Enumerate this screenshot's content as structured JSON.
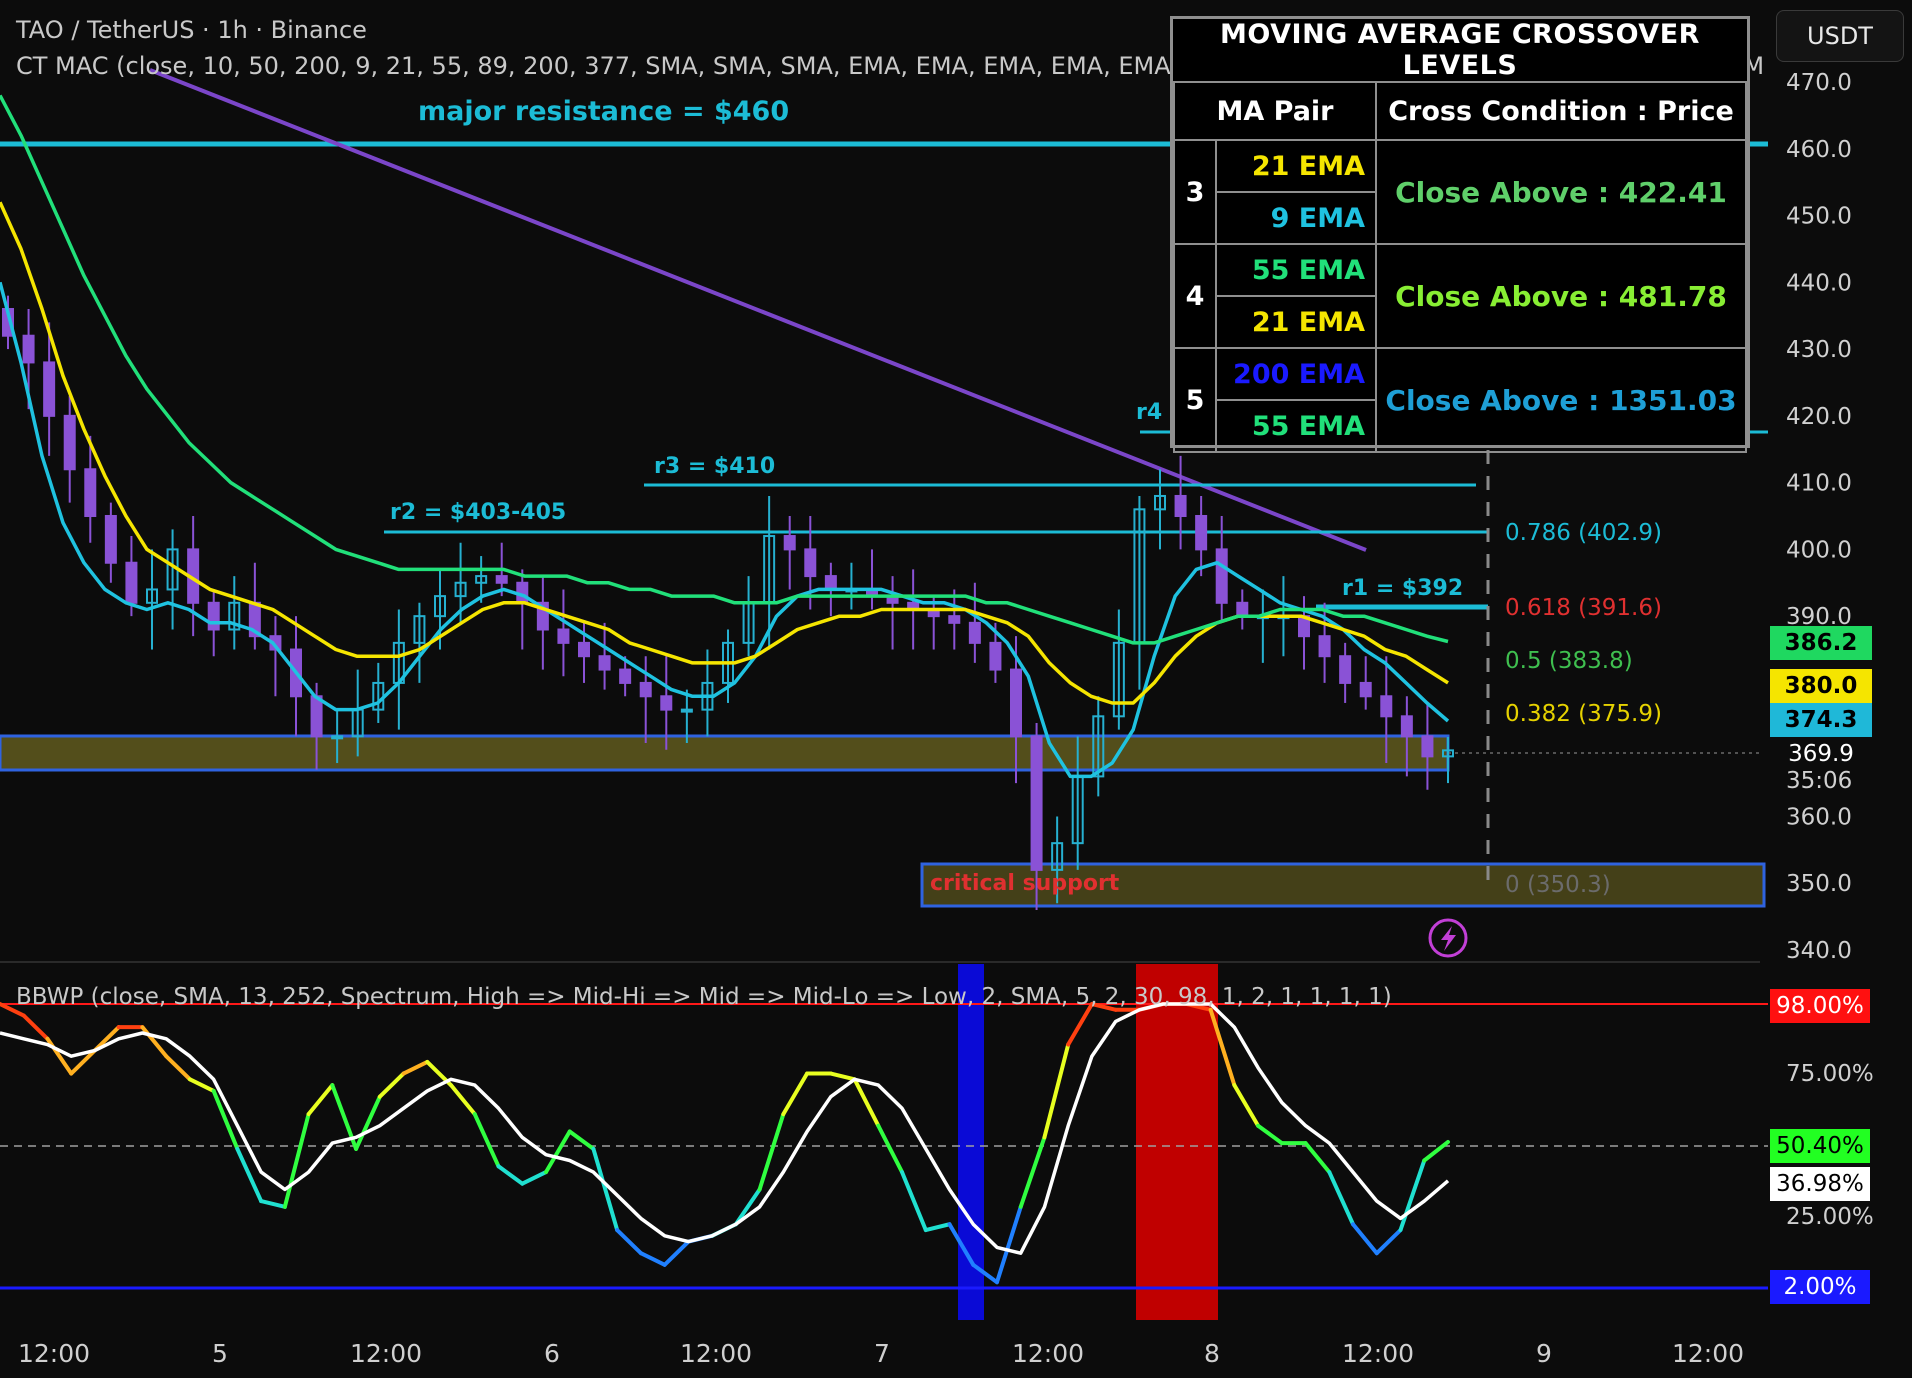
{
  "header": {
    "symbol_line": "TAO / TetherUS · 1h · Binance",
    "indicator_line": "CT MAC (close, 10, 50, 200, 9, 21, 55, 89, 200, 377, SMA, SMA, SMA, EMA, EMA, EMA, EMA, EMA, 2, MA 1, MA 2, MA 2, MA 3, MA 4, MA 5, MA 5, M",
    "currency_button": "USDT"
  },
  "ma_table": {
    "title": "MOVING AVERAGE CROSSOVER LEVELS",
    "col_pair": "MA Pair",
    "col_cond": "Cross Condition : Price",
    "rows": [
      {
        "idx": "3",
        "ma_a": "21 EMA",
        "ma_a_color": "#f5e500",
        "ma_b": "9 EMA",
        "ma_b_color": "#1fc2e0",
        "cond": "Close Above : 422.41",
        "cond_color": "#5fcf6a"
      },
      {
        "idx": "4",
        "ma_a": "55 EMA",
        "ma_a_color": "#21e07a",
        "ma_b": "21 EMA",
        "ma_b_color": "#f5e500",
        "cond": "Close Above : 481.78",
        "cond_color": "#88ee33"
      },
      {
        "idx": "5",
        "ma_a": "200 EMA",
        "ma_a_color": "#1a1aff",
        "ma_b": "55 EMA",
        "ma_b_color": "#21e07a",
        "cond": "Close Above : 1351.03",
        "cond_color": "#1e9fd6"
      }
    ]
  },
  "annotations": {
    "major_resistance": "major resistance = $460",
    "r1": "r1 = $392",
    "r2": "r2 = $403-405",
    "r3": "r3 = $410",
    "r4": "r4 =",
    "critical_support": "critical support",
    "fib_0786": "0.786 (402.9)",
    "fib_0618": "0.618 (391.6)",
    "fib_05": "0.5 (383.8)",
    "fib_0382": "0.382 (375.9)",
    "fib_0": "0 (350.3)",
    "countdown": "35:06"
  },
  "price_tags": [
    {
      "text": "386.2",
      "bg": "#1fd860",
      "fg": "#000000"
    },
    {
      "text": "380.0",
      "bg": "#f5e500",
      "fg": "#000000"
    },
    {
      "text": "374.3",
      "bg": "#1fb8d8",
      "fg": "#000000"
    },
    {
      "text": "369.9",
      "bg": "#0c0c0c",
      "fg": "#ffffff"
    }
  ],
  "bbwp": {
    "label": "BBWP (close, SMA, 13, 252, Spectrum, High => Mid-Hi => Mid => Mid-Lo => Low, 2, SMA, 5, 2, 30, 98, 1, 2, 1, 1, 1, 1)",
    "y_ticks": [
      "75.00%",
      "25.00%"
    ],
    "tags": [
      {
        "text": "98.00%",
        "bg": "#ff1010",
        "fg": "#ffffff"
      },
      {
        "text": "50.40%",
        "bg": "#22ff22",
        "fg": "#000000"
      },
      {
        "text": "36.98%",
        "bg": "#ffffff",
        "fg": "#000000"
      },
      {
        "text": "2.00%",
        "bg": "#1a1aff",
        "fg": "#ffffff"
      }
    ]
  },
  "chart_data": {
    "type": "candlestick",
    "title": "TAO / TetherUS · 1h · Binance",
    "y_axis_ticks": [
      470.0,
      460.0,
      450.0,
      440.0,
      430.0,
      420.0,
      410.0,
      400.0,
      390.0,
      380.0,
      370.0,
      360.0,
      350.0,
      340.0
    ],
    "ylim": [
      338,
      474
    ],
    "x_axis_ticks": [
      "12:00",
      "5",
      "12:00",
      "6",
      "12:00",
      "7",
      "12:00",
      "8",
      "12:00",
      "9",
      "12:00"
    ],
    "last_price": 369.9,
    "close_series_approx": [
      432,
      428,
      420,
      412,
      405,
      398,
      392,
      394,
      400,
      392,
      388,
      392,
      387,
      385,
      378,
      372,
      372,
      376,
      380,
      386,
      390,
      393,
      395,
      396,
      395,
      392,
      388,
      386,
      384,
      382,
      380,
      378,
      376,
      376,
      380,
      386,
      392,
      402,
      400,
      396,
      394,
      394,
      393,
      392,
      391,
      390,
      389,
      386,
      382,
      372,
      352,
      356,
      366,
      375,
      386,
      406,
      408,
      405,
      400,
      392,
      390,
      390,
      390,
      387,
      384,
      380,
      378,
      375,
      372,
      369,
      369.9
    ],
    "moving_averages": [
      {
        "name": "9 EMA",
        "color": "#1fc2e0",
        "values": [
          440,
          428,
          414,
          404,
          398,
          394,
          392,
          391,
          392,
          391,
          389,
          389,
          388,
          386,
          382,
          378,
          376,
          376,
          377,
          380,
          384,
          388,
          391,
          393,
          394,
          393,
          391,
          389,
          387,
          385,
          383,
          381,
          379,
          378,
          378,
          380,
          384,
          390,
          393,
          394,
          394,
          394,
          394,
          393,
          392,
          392,
          391,
          389,
          386,
          381,
          371,
          366,
          366,
          368,
          373,
          384,
          393,
          397,
          398,
          396,
          394,
          392,
          391,
          390,
          388,
          385,
          383,
          380,
          377,
          374.3
        ]
      },
      {
        "name": "21 EMA",
        "color": "#f5e500",
        "values": [
          452,
          445,
          436,
          426,
          418,
          411,
          405,
          400,
          398,
          396,
          394,
          393,
          392,
          391,
          389,
          387,
          385,
          384,
          384,
          384,
          385,
          387,
          389,
          391,
          392,
          392,
          391,
          390,
          389,
          388,
          386,
          385,
          384,
          383,
          383,
          383,
          384,
          386,
          388,
          389,
          390,
          390,
          391,
          391,
          391,
          391,
          391,
          390,
          389,
          387,
          383,
          380,
          378,
          377,
          377,
          380,
          384,
          387,
          389,
          390,
          390,
          390,
          390,
          389,
          388,
          387,
          385,
          384,
          382,
          380.0
        ]
      },
      {
        "name": "55 EMA",
        "color": "#21e07a",
        "values": [
          468,
          462,
          455,
          448,
          441,
          435,
          429,
          424,
          420,
          416,
          413,
          410,
          408,
          406,
          404,
          402,
          400,
          399,
          398,
          397,
          397,
          397,
          397,
          397,
          397,
          396,
          396,
          396,
          395,
          395,
          394,
          394,
          393,
          393,
          393,
          392,
          392,
          392,
          393,
          393,
          393,
          393,
          393,
          393,
          393,
          393,
          393,
          392,
          392,
          391,
          390,
          389,
          388,
          387,
          386,
          386,
          387,
          388,
          389,
          390,
          390,
          391,
          391,
          391,
          390,
          390,
          389,
          388,
          387,
          386.2
        ]
      }
    ],
    "bbwp_series": {
      "name": "BBWP",
      "ylim": [
        0,
        100
      ],
      "values": [
        98,
        94,
        86,
        74,
        82,
        90,
        90,
        80,
        72,
        68,
        48,
        30,
        28,
        60,
        70,
        48,
        66,
        74,
        78,
        70,
        60,
        42,
        36,
        40,
        54,
        48,
        20,
        12,
        8,
        16,
        18,
        22,
        34,
        60,
        74,
        74,
        72,
        56,
        40,
        20,
        22,
        8,
        2,
        28,
        52,
        84,
        98,
        96,
        96,
        98,
        98,
        96,
        70,
        56,
        50,
        50,
        40,
        22,
        12,
        20,
        44,
        50.4
      ],
      "signal_values": [
        88,
        86,
        84,
        80,
        82,
        86,
        88,
        86,
        80,
        72,
        56,
        40,
        34,
        40,
        50,
        52,
        56,
        62,
        68,
        72,
        70,
        62,
        52,
        46,
        44,
        40,
        32,
        24,
        18,
        16,
        18,
        22,
        28,
        40,
        54,
        66,
        72,
        70,
        62,
        48,
        34,
        22,
        14,
        12,
        28,
        56,
        80,
        92,
        96,
        98,
        98,
        98,
        90,
        76,
        64,
        56,
        50,
        40,
        30,
        24,
        30,
        36.98
      ]
    }
  }
}
